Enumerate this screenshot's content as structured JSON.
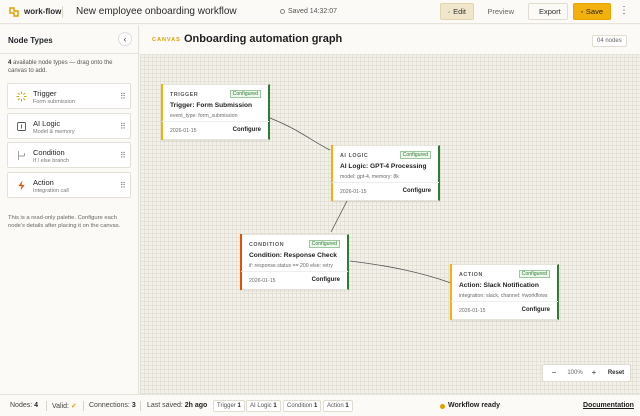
{
  "app": {
    "brand": "work-flow",
    "doc_title": "New employee onboarding workflow",
    "saved_status": "Saved 14:32:07"
  },
  "toolbar": {
    "edit_label": "Edit",
    "preview_label": "Preview",
    "export_label": "Export",
    "save_label": "Save",
    "more_label": "⋮"
  },
  "sidebar": {
    "title": "Node Types",
    "collapse_label": "‹",
    "desc_count": "4",
    "desc_text": " available node types — drag onto the canvas to add.",
    "items": [
      {
        "label": "Trigger",
        "sub": "Form submission",
        "icon": "bolt-icon"
      },
      {
        "label": "AI Logic",
        "sub": "Model & memory",
        "icon": "chip-icon"
      },
      {
        "label": "Condition",
        "sub": "If / else branch",
        "icon": "branch-icon"
      },
      {
        "label": "Action",
        "sub": "Integration call",
        "icon": "lightning-icon"
      }
    ],
    "footnote": "This is a read-only palette. Configure each node's details after placing it on the canvas."
  },
  "canvas": {
    "tag": "CANVAS",
    "title": "Onboarding automation graph",
    "node_count": "04 nodes",
    "nodes": [
      {
        "type": "TRIGGER",
        "badge": "Configured",
        "title": "Trigger: Form Submission",
        "detail": "event_type: form_submission",
        "date": "2026-01-15",
        "action": "Configure"
      },
      {
        "type": "AI LOGIC",
        "badge": "Configured",
        "title": "AI Logic: GPT-4 Processing",
        "detail": "model: gpt-4, memory: 8k",
        "date": "2026-01-15",
        "action": "Configure"
      },
      {
        "type": "CONDITION",
        "badge": "Configured",
        "title": "Condition: Response Check",
        "detail": "if: response.status == 200 else: retry",
        "date": "2026-01-15",
        "action": "Configure"
      },
      {
        "type": "ACTION",
        "badge": "Configured",
        "title": "Action: Slack Notification",
        "detail": "integration: slack, channel: #workflows",
        "date": "2026-01-15",
        "action": "Configure"
      }
    ],
    "zoom": {
      "out": "−",
      "level": "100%",
      "in": "+",
      "reset": "Reset"
    }
  },
  "statusbar": {
    "nodes_label": "Nodes:",
    "nodes_value": "4",
    "valid_label": "Valid:",
    "valid_value": "✓",
    "connections_label": "Connections:",
    "connections_value": "3",
    "last_saved_label": "Last saved:",
    "last_saved_value": "2h ago",
    "type_counts": [
      {
        "label": "Trigger",
        "count": "1"
      },
      {
        "label": "AI Logic",
        "count": "1"
      },
      {
        "label": "Condition",
        "count": "1"
      },
      {
        "label": "Action",
        "count": "1"
      }
    ],
    "ready_label": "Workflow ready",
    "docs_label": "Documentation"
  },
  "colors": {
    "accent": "#f2b10d",
    "trigger": "#f2b10d",
    "ai_logic": "#f2b10d",
    "condition": "#e65100",
    "action": "#f2b10d",
    "configured": "#2e7d32"
  }
}
